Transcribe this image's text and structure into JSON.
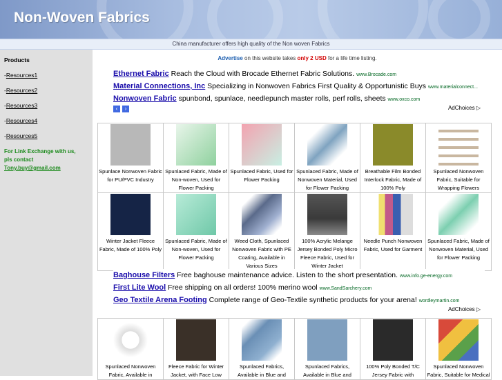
{
  "header": {
    "title": "Non-Woven Fabrics",
    "tagline": "China manufacturer offers high quality of the Non woven Fabrics"
  },
  "sidebar": {
    "heading": "Products",
    "links": [
      {
        "label": "Resources1"
      },
      {
        "label": "Resources2"
      },
      {
        "label": "Resources3"
      },
      {
        "label": "Resources4"
      },
      {
        "label": "Resources5"
      }
    ],
    "contact_line1": "For Link Exchange with us,",
    "contact_line2": "pls contact",
    "contact_email": "Tony.buy@gmail.com"
  },
  "advertise": {
    "lead": "Advertise",
    "mid": "on this website takes",
    "price": "only 2 USD",
    "tail": "for a life time listing."
  },
  "ads_top": [
    {
      "title": "Ethernet Fabric",
      "text": "Reach the Cloud with Brocade Ethernet Fabric Solutions.",
      "url": "www.Brocade.com"
    },
    {
      "title": "Material Connections, Inc",
      "text": "Specializing in Nonwoven Fabrics First Quality & Opportunistic Buys",
      "url": "www.materialconnect..."
    },
    {
      "title": "Nonwoven Fabric",
      "text": "spunbond, spunlace, needlepunch master rolls, perf rolls, sheets",
      "url": "www.oxco.com"
    }
  ],
  "ads_mid": [
    {
      "title": "Baghouse Filters",
      "text": "Free baghouse maintenance advice. Listen to the short presentation.",
      "url": "www.info.ge-energy.com"
    },
    {
      "title": "First Lite Wool",
      "text": "Free shipping on all orders! 100% merino wool",
      "url": "www.SandSarchery.com"
    },
    {
      "title": "Geo Textile Arena Footing",
      "text": "Complete range of Geo-Textile synthetic products for your arena!",
      "url": "wordleymartin.com"
    }
  ],
  "adchoices": "AdChoices",
  "arrows": {
    "prev": "‹",
    "next": "›"
  },
  "products_row1": [
    {
      "caption": "Spunlace Nonwoven Fabric for PU/PVC Industry",
      "color": "#b8b8b8"
    },
    {
      "caption": "Spunlaced Fabric, Made of Non-woven, Used for Flower Packing",
      "color": "#8fd19e"
    },
    {
      "caption": "Spunlaced Fabric, Used for Flower Packing",
      "color": "#c8efe3"
    },
    {
      "caption": "Spunlaced Fabric, Made of Nonwoven Material, Used for Flower Packing",
      "color": "#7fa3c0"
    },
    {
      "caption": "Breathable Film Bonded Interlock Fabric, Made of 100% Poly",
      "color": "#8a8a2a"
    },
    {
      "caption": "Spunlaced Nonwoven Fabric, Suitable for Wrapping Flowers",
      "color": "#c9b7a0"
    }
  ],
  "products_row2": [
    {
      "caption": "Winter Jacket Fleece Fabric, Made of 100% Poly",
      "color": "#152446"
    },
    {
      "caption": "Spunlaced Fabric, Made of Non-woven, Used for Flower Packing",
      "color": "#6fc8a8"
    },
    {
      "caption": "Weed Cloth, Spunlaced Nonwoven Fabric with PE Coating, Available in Various Sizes",
      "color": "#5a6a8a"
    },
    {
      "caption": "100% Acrylic Melange Jersey Bonded Poly Micro Fleece Fabric, Used for Winter Jacket",
      "color": "#3a3a3a"
    },
    {
      "caption": "Needle Punch Nonwoven Fabric, Used for Garment",
      "color": "#c25a8a"
    },
    {
      "caption": "Spunlaced Fabric, Made of Nonwoven Material, Used for Flower Packing",
      "color": "#7ccfb0"
    }
  ],
  "products_row3": [
    {
      "caption": "Spunlaced Nonwoven Fabric, Available in",
      "color": "#e8e8e8"
    },
    {
      "caption": "Fleece Fabric for Winter Jacket, with Face Low",
      "color": "#3a3028"
    },
    {
      "caption": "Spunlaced Fabrics, Available in Blue and",
      "color": "#6a8fb5"
    },
    {
      "caption": "Spunlaced Fabrics, Available in Blue and",
      "color": "#7f9fbf"
    },
    {
      "caption": "100% Poly Bonded T/C Jersey Fabric with",
      "color": "#2a2a2a"
    },
    {
      "caption": "Spunlaced Nonwoven Fabric, Suitable for Medical",
      "color": "#d84a3a"
    }
  ]
}
